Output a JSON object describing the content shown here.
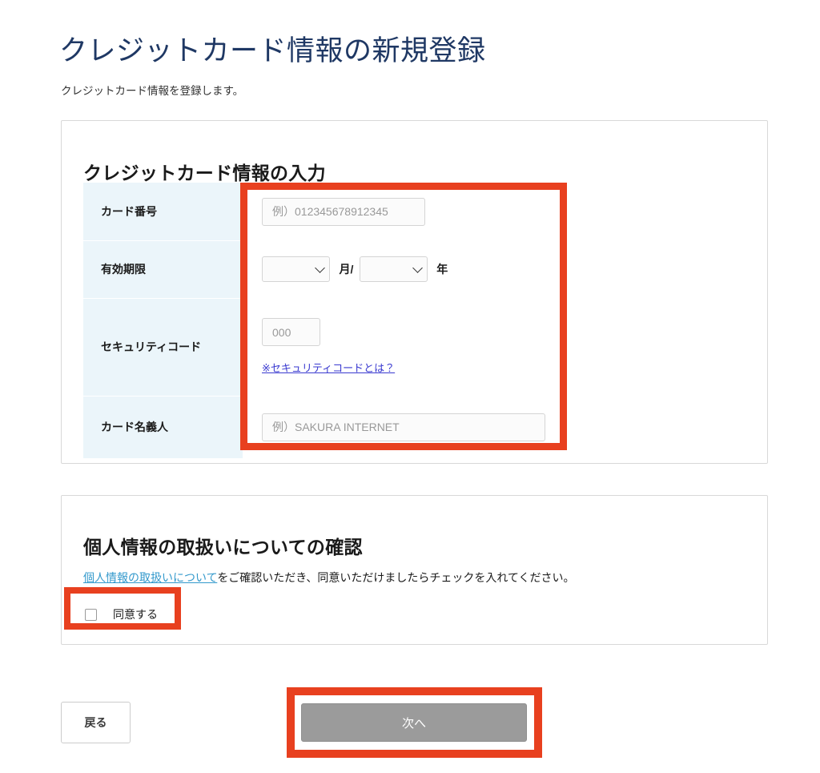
{
  "page": {
    "title": "クレジットカード情報の新規登録",
    "subtitle": "クレジットカード情報を登録します。",
    "title_color": "#1f3864"
  },
  "card_panel": {
    "heading": "クレジットカード情報の入力",
    "rows": [
      {
        "key": "card-number",
        "label": "カード番号",
        "input_placeholder": "例）012345678912345",
        "input_value": ""
      },
      {
        "key": "expiry",
        "label": "有効期限",
        "month_value": "",
        "month_unit": "月/",
        "year_value": "",
        "year_unit": "年"
      },
      {
        "key": "security-code",
        "label": "セキュリティコード",
        "input_placeholder": "000",
        "input_value": "",
        "help_link": "※セキュリティコードとは？"
      },
      {
        "key": "holder-name",
        "label": "カード名義人",
        "input_placeholder": "例）SAKURA INTERNET",
        "input_value": ""
      }
    ]
  },
  "privacy_panel": {
    "heading": "個人情報の取扱いについての確認",
    "link_text": "個人情報の取扱いについて",
    "description_rest": "をご確認いただき、同意いただけましたらチェックを入れてください。",
    "agree_label": "同意する",
    "agree_checked": false
  },
  "actions": {
    "back_label": "戻る",
    "next_label": "次へ",
    "next_disabled": true,
    "next_bg": "#9b9b9b"
  },
  "annotations": {
    "color": "#e8401f",
    "boxes": [
      {
        "name": "card-fields-highlight"
      },
      {
        "name": "agree-checkbox-highlight"
      },
      {
        "name": "next-button-highlight"
      }
    ]
  }
}
